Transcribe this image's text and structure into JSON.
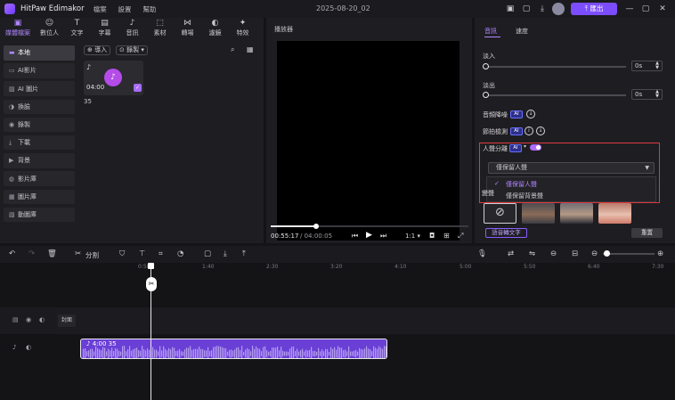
{
  "app": {
    "name": "HitPaw Edimakor",
    "menu": [
      "檔案",
      "設置",
      "幫助"
    ],
    "doc_title": "2025-08-20_02",
    "export_label": "匯出"
  },
  "tools": [
    {
      "label": "媒體檔案",
      "icon": "folder-icon",
      "glyph": "▣"
    },
    {
      "label": "數位人",
      "icon": "avatar-icon",
      "glyph": "☺"
    },
    {
      "label": "文字",
      "icon": "text-icon",
      "glyph": "T"
    },
    {
      "label": "字幕",
      "icon": "subtitle-icon",
      "glyph": "▤"
    },
    {
      "label": "音訊",
      "icon": "music-icon",
      "glyph": "♪"
    },
    {
      "label": "素材",
      "icon": "sticker-icon",
      "glyph": "⬚"
    },
    {
      "label": "轉場",
      "icon": "transition-icon",
      "glyph": "⋈"
    },
    {
      "label": "濾鏡",
      "icon": "filter-icon",
      "glyph": "◐"
    },
    {
      "label": "特效",
      "icon": "effects-icon",
      "glyph": "✦"
    }
  ],
  "sidebar": [
    {
      "label": "本地",
      "icon": "folder-icon",
      "glyph": "▬",
      "active": true
    },
    {
      "label": "AI影片",
      "icon": "ai-video-icon",
      "glyph": "▭"
    },
    {
      "label": "AI 圖片",
      "icon": "ai-image-icon",
      "glyph": "▨"
    },
    {
      "label": "換臉",
      "icon": "face-swap-icon",
      "glyph": "◑"
    },
    {
      "label": "錄製",
      "icon": "record-icon",
      "glyph": "◉"
    },
    {
      "label": "下載",
      "icon": "download-icon",
      "glyph": "⤓"
    },
    {
      "label": "背景",
      "icon": "background-icon",
      "glyph": "▶"
    },
    {
      "label": "影片庫",
      "icon": "video-library-icon",
      "glyph": "◍"
    },
    {
      "label": "圖片庫",
      "icon": "image-library-icon",
      "glyph": "▦"
    },
    {
      "label": "動圖庫",
      "icon": "gif-library-icon",
      "glyph": "▧"
    }
  ],
  "media": {
    "import_label": "⊕ 導入",
    "record_label": "⊙ 錄製 ▾",
    "clip_duration": "04:00",
    "clip_name": "35"
  },
  "player": {
    "title": "播放器",
    "current_time": "00:55:17",
    "total_time": "/ 04:00:05",
    "zoom": "1:1 ▾"
  },
  "props": {
    "tabs": [
      "音訊",
      "速度"
    ],
    "fade_in": {
      "label": "淡入",
      "value": "0s"
    },
    "fade_out": {
      "label": "淡出",
      "value": "0s"
    },
    "denoise_label": "音頻降噪",
    "beat_label": "節拍檢測",
    "ai_badge": "AI",
    "vocal_sep_label": "人聲分離",
    "select_value": "僅保留人聲",
    "options": [
      "僅保留人聲",
      "僅保留背景聲"
    ],
    "selected_option": 0,
    "partial_label": "變聲",
    "speech_to_text": "語音轉文字",
    "reset": "重置"
  },
  "timeline": {
    "split_label": "分割",
    "ruler": [
      "0:50",
      "1:40",
      "2:30",
      "3:20",
      "4:10",
      "5:00",
      "5:50",
      "6:40",
      "7:30"
    ],
    "cover_label": "封面",
    "audio_clip_label": "4:00 35"
  },
  "colors": {
    "accent": "#7c4dff",
    "accent_light": "#b085ff",
    "highlight_red": "#e0393e",
    "clip": "#6a3fd6"
  }
}
